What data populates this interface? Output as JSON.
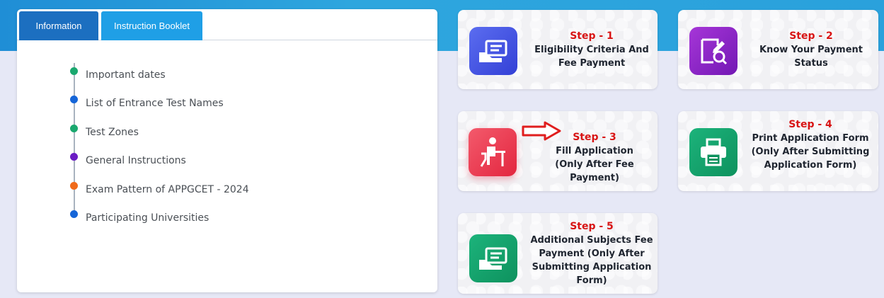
{
  "tabs": [
    {
      "label": "Information"
    },
    {
      "label": "Instruction Booklet"
    }
  ],
  "timeline": [
    {
      "label": "Important dates",
      "color": "#1aa86f"
    },
    {
      "label": "List of Entrance Test Names",
      "color": "#1565d8"
    },
    {
      "label": "Test Zones",
      "color": "#1aa86f"
    },
    {
      "label": "General Instructions",
      "color": "#6a1cc4"
    },
    {
      "label": "Exam Pattern of APPGCET - 2024",
      "color": "#f06a1a"
    },
    {
      "label": "Participating Universities",
      "color": "#1565d8"
    }
  ],
  "steps": [
    {
      "title": "Step - 1",
      "lines": [
        "Eligibility Criteria And",
        "Fee Payment"
      ],
      "icon": "card-payment-icon",
      "icon_color": "#3f56e6"
    },
    {
      "title": "Step - 2",
      "lines": [
        "Know Your Payment",
        "Status"
      ],
      "icon": "document-search-icon",
      "icon_color": "#8a26c4"
    },
    {
      "title": "Step - 3",
      "lines": [
        "Fill Application",
        "(Only After Fee",
        "Payment)"
      ],
      "icon": "student-desk-icon",
      "icon_color": "#ec3c54"
    },
    {
      "title": "Step - 4",
      "lines": [
        "Print Application Form",
        "(Only After Submitting",
        "Application Form)"
      ],
      "icon": "printer-icon",
      "icon_color": "#13a06a"
    },
    {
      "title": "Step - 5",
      "lines": [
        "Additional Subjects Fee",
        "Payment (Only After",
        "Submitting Application",
        "Form)"
      ],
      "icon": "card-payment-icon",
      "icon_color": "#13a06a"
    }
  ],
  "colors": {
    "header_band": "#2aa1dc",
    "step_title": "#d81414",
    "arrow": "#e01e1e"
  }
}
